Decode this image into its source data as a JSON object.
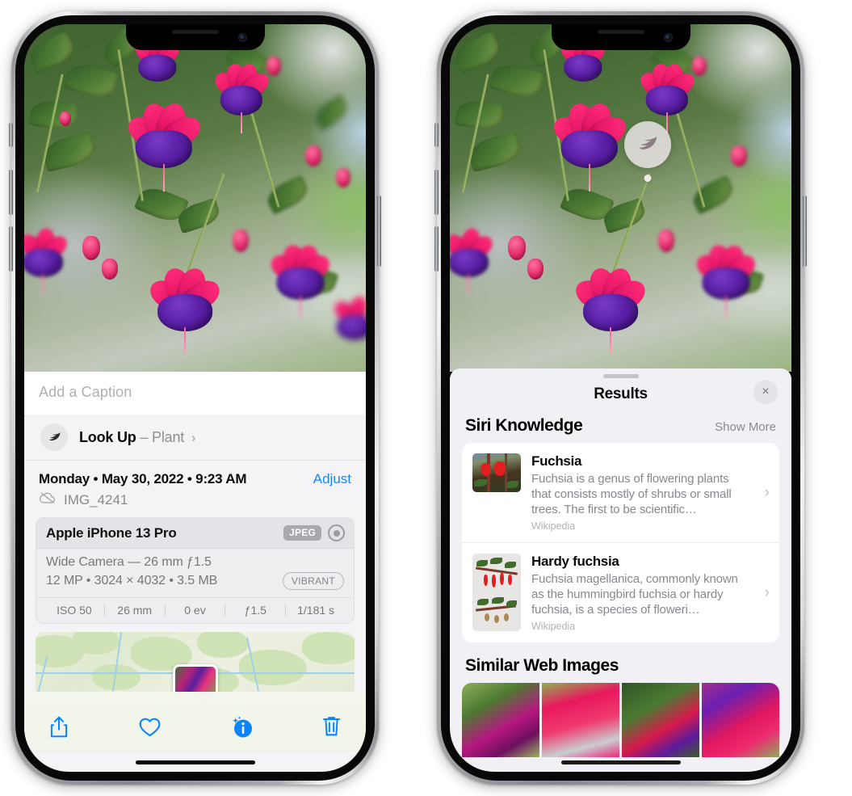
{
  "left_phone": {
    "caption_placeholder": "Add a Caption",
    "lookup": {
      "label": "Look Up",
      "dash": "–",
      "category": "Plant",
      "chevron": "›",
      "icon": "leaf-icon"
    },
    "date_line": "Monday • May 30, 2022 • 9:23 AM",
    "adjust_label": "Adjust",
    "file_name": "IMG_4241",
    "exif": {
      "device": "Apple iPhone 13 Pro",
      "format_tag": "JPEG",
      "lens_line": "Wide Camera — 26 mm ƒ1.5",
      "size_line": "12 MP • 3024 × 4032 • 3.5 MB",
      "style_tag": "VIBRANT",
      "stats": [
        "ISO 50",
        "26 mm",
        "0 ev",
        "ƒ1.5",
        "1/181 s"
      ]
    },
    "toolbar": {
      "share_label": "Share",
      "favorite_label": "Favorite",
      "info_label": "Info",
      "delete_label": "Delete"
    }
  },
  "right_phone": {
    "badge_icon": "leaf-icon",
    "sheet": {
      "title": "Results",
      "close_label": "×"
    },
    "siri_knowledge": {
      "title": "Siri Knowledge",
      "show_more": "Show More",
      "items": [
        {
          "title": "Fuchsia",
          "description": "Fuchsia is a genus of flowering plants that consists mostly of shrubs or small trees. The first to be scientific…",
          "source": "Wikipedia",
          "chevron": "›"
        },
        {
          "title": "Hardy fuchsia",
          "description": "Fuchsia magellanica, commonly known as the hummingbird fuchsia or hardy fuchsia, is a species of floweri…",
          "source": "Wikipedia",
          "chevron": "›"
        }
      ]
    },
    "similar_web_images": {
      "title": "Similar Web Images",
      "count": 4
    }
  },
  "colors": {
    "accent_blue": "#0a84ff",
    "link_blue": "#1886fd",
    "sheet_bg": "#f1f1f5",
    "card_bg": "#ffffff",
    "muted_text": "#8a8a90"
  }
}
